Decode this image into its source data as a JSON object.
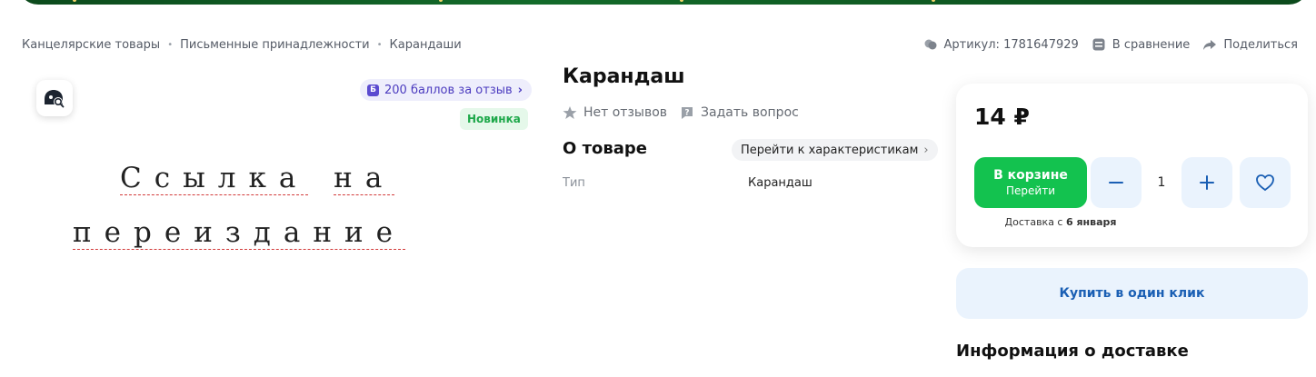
{
  "breadcrumbs": [
    "Канцелярские товары",
    "Письменные принадлежности",
    "Карандаши"
  ],
  "meta": {
    "article": "Артикул: 1781647929",
    "compare": "В сравнение",
    "share": "Поделиться"
  },
  "gallery": {
    "bonus_label": "200 баллов за отзыв",
    "bonus_icon": "Б",
    "new_badge": "Новинка",
    "placeholder_line1_a": "Ссылка",
    "placeholder_line1_b": "на",
    "placeholder_line2": "переиздание"
  },
  "product": {
    "title": "Карандаш",
    "reviews": "Нет отзывов",
    "ask": "Задать вопрос",
    "about_title": "О товаре",
    "to_specs": "Перейти к характеристикам",
    "specs": [
      {
        "name": "Тип",
        "value": "Карандаш"
      }
    ]
  },
  "buy": {
    "price": "14 ₽",
    "cart_line1": "В корзине",
    "cart_line2": "Перейти",
    "quantity": "1",
    "delivery_prefix": "Доставка с",
    "delivery_date": "6 января",
    "one_click": "Купить в один клик",
    "delivery_info_title": "Информация о доставке"
  },
  "colors": {
    "accent_green": "#13c24f",
    "accent_blue": "#1a5fb4",
    "light_blue": "#eaf3fd",
    "bonus_purple": "#5b4bd0"
  }
}
